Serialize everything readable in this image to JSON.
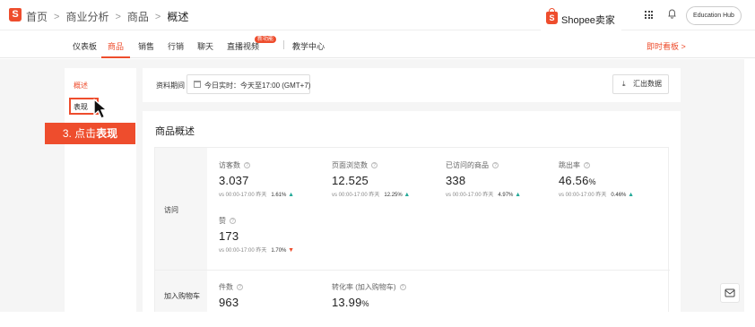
{
  "breadcrumb": {
    "items": [
      "首页",
      "商业分析",
      "商品",
      "概述"
    ],
    "separator": ">"
  },
  "brand": {
    "text": "Shopee卖家"
  },
  "header": {
    "education_hub": "Education Hub"
  },
  "nav": {
    "tabs": [
      "仪表板",
      "商品",
      "销售",
      "行销",
      "聊天",
      "直播视频",
      "教学中心"
    ],
    "active_tab": "商品",
    "new_badge": "新功能",
    "right_link": "即时看板 >"
  },
  "leftnav": {
    "items": [
      "概述",
      "表现"
    ],
    "active": "概述"
  },
  "callout": {
    "prefix": "3. 点击",
    "bold": "表现"
  },
  "period": {
    "label": "资料期间",
    "value": "今日实时：今天至17:00 (GMT+7)",
    "export_label": "汇出数据"
  },
  "overview": {
    "title": "商品概述",
    "row_labels": [
      "访问",
      "加入购物车"
    ],
    "metrics": [
      {
        "label": "访客数",
        "value": "3.037",
        "cmp": "vs 00:00-17:00 昨天",
        "pct": "1.61%",
        "dir": "up"
      },
      {
        "label": "页面浏览数",
        "value": "12.525",
        "cmp": "vs 00:00-17:00 昨天",
        "pct": "12.25%",
        "dir": "up"
      },
      {
        "label": "已访问的商品",
        "value": "338",
        "cmp": "vs 00:00-17:00 昨天",
        "pct": "4.97%",
        "dir": "up"
      },
      {
        "label": "跳出率",
        "value": "46.56",
        "unit": "%",
        "cmp": "vs 00:00-17:00 昨天",
        "pct": "0.46%",
        "dir": "up"
      },
      {
        "label": "赞",
        "value": "173",
        "cmp": "vs 00:00-17:00 昨天",
        "pct": "1.70%",
        "dir": "down"
      },
      {
        "label": "件数",
        "value": "963"
      },
      {
        "label": "转化率 (加入购物车)",
        "value": "13.99",
        "unit": "%"
      }
    ]
  },
  "colors": {
    "accent": "#ee4d2d",
    "up": "#26aa99"
  },
  "icons": [
    "shopee-bag-icon",
    "apps-grid-icon",
    "bell-icon",
    "calendar-icon",
    "download-icon",
    "help-circle-icon",
    "cursor-arrow-icon",
    "chat-icon"
  ]
}
